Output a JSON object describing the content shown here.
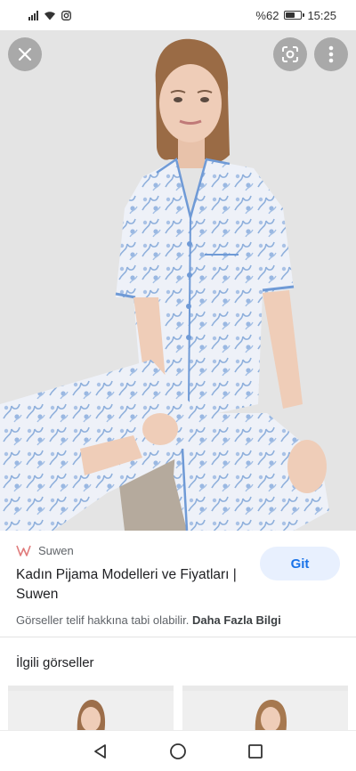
{
  "status_bar": {
    "battery_text": "%62",
    "time": "15:25",
    "battery_level": 0.62,
    "icons": [
      "signal-icon",
      "wifi-icon",
      "instagram-icon",
      "battery-icon"
    ]
  },
  "viewer": {
    "close_icon": "close-icon",
    "lens_icon": "lens-icon",
    "more_icon": "more-vert-icon"
  },
  "result": {
    "source_name": "Suwen",
    "title": "Kadın Pijama Modelleri ve Fiyatları | Suwen",
    "go_button_label": "Git",
    "copyright_text": "Görseller telif hakkına tabi olabilir.",
    "more_info_link": "Daha Fazla Bilgi"
  },
  "related": {
    "heading": "İlgili görseller"
  },
  "colors": {
    "accent": "#1a73e8",
    "go_button_bg": "#e8f0fe",
    "pajama_blue": "#7ea6d8"
  }
}
